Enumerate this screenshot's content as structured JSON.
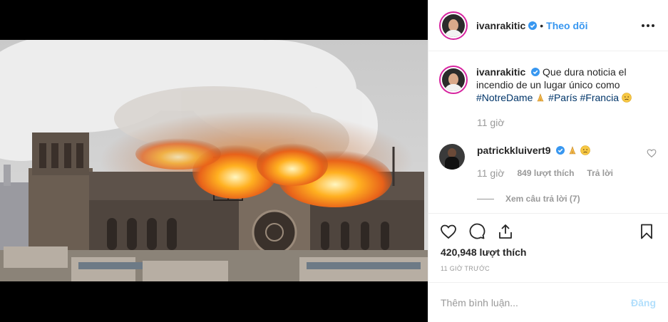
{
  "post": {
    "image_alt": "Notre Dame fire",
    "owner": "ivanrakitic",
    "follow_label": "Theo dõi",
    "dot": "•"
  },
  "caption": {
    "user": "ivanrakitic",
    "text": "Que dura noticia el incendio de un lugar único como",
    "tags": [
      "#NotreDame",
      "#París",
      "#Francia"
    ],
    "time": "11 giờ"
  },
  "comment": {
    "user": "patrickkluivert9",
    "time": "11 giờ",
    "likes": "849 lượt thích",
    "reply": "Trả lời",
    "view_replies": "Xem câu trả lời (7)"
  },
  "stats": {
    "likes": "420,948 lượt thích",
    "posted_ago": "11 GIỜ TRƯỚC"
  },
  "add_comment": {
    "placeholder": "Thêm bình luận...",
    "post_label": "Đăng"
  },
  "colors": {
    "accent": "#3897f0",
    "post_disabled": "#b2dffc",
    "hashtag": "#003569",
    "muted": "#999999"
  },
  "icons": [
    "verified-icon",
    "more-icon",
    "heart-icon",
    "comment-icon",
    "share-icon",
    "bookmark-icon",
    "pray-emoji",
    "sad-emoji"
  ]
}
